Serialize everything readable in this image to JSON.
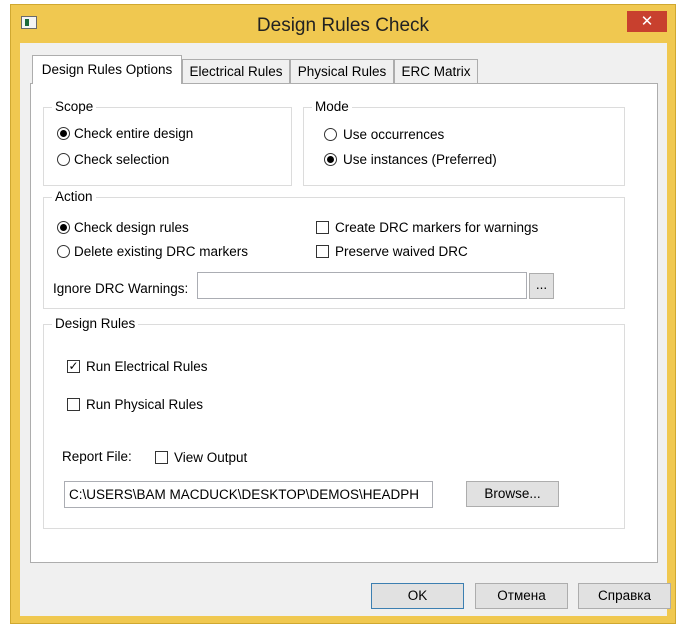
{
  "window": {
    "title": "Design Rules Check",
    "close_glyph": "✕"
  },
  "tabs": [
    {
      "label": "Design Rules Options",
      "active": true
    },
    {
      "label": "Electrical Rules",
      "active": false
    },
    {
      "label": "Physical Rules",
      "active": false
    },
    {
      "label": "ERC Matrix",
      "active": false
    }
  ],
  "scope": {
    "legend": "Scope",
    "options": [
      {
        "label": "Check entire design",
        "selected": true
      },
      {
        "label": "Check selection",
        "selected": false
      }
    ]
  },
  "mode": {
    "legend": "Mode",
    "options": [
      {
        "label": "Use occurrences",
        "selected": false
      },
      {
        "label": "Use instances (Preferred)",
        "selected": true
      }
    ]
  },
  "action": {
    "legend": "Action",
    "radios": [
      {
        "label": "Check design rules",
        "selected": true
      },
      {
        "label": "Delete existing DRC markers",
        "selected": false
      }
    ],
    "checks": [
      {
        "label": "Create DRC markers for warnings",
        "checked": false
      },
      {
        "label": "Preserve waived DRC",
        "checked": false
      }
    ],
    "ignore_label": "Ignore DRC Warnings:",
    "ignore_value": "",
    "browse_dots": "..."
  },
  "design_rules": {
    "legend": "Design Rules",
    "run_electrical": {
      "label": "Run Electrical Rules",
      "checked": true
    },
    "run_physical": {
      "label": "Run Physical Rules",
      "checked": false
    },
    "report_file_label": "Report File:",
    "view_output": {
      "label": "View Output",
      "checked": false
    },
    "report_path": "C:\\USERS\\BAM MACDUCK\\DESKTOP\\DEMOS\\HEADPH",
    "browse_label": "Browse..."
  },
  "buttons": {
    "ok": "OK",
    "cancel": "Отмена",
    "help": "Справка"
  },
  "check_glyph": "✓"
}
